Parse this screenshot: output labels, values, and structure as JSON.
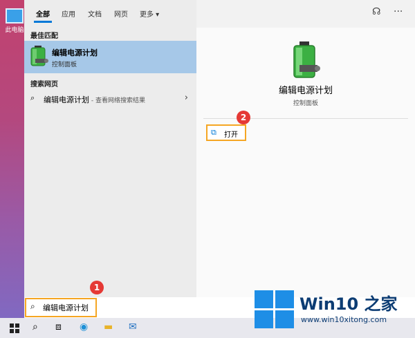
{
  "desktop": {
    "icon_label": "此电脑"
  },
  "tabs": [
    {
      "label": "全部"
    },
    {
      "label": "应用"
    },
    {
      "label": "文档"
    },
    {
      "label": "网页"
    },
    {
      "label": "更多 ▾"
    }
  ],
  "sections": {
    "best_match": "最佳匹配",
    "web_search": "搜索网页"
  },
  "best_match": {
    "title": "编辑电源计划",
    "subtitle": "控制面板"
  },
  "web_result": {
    "text": "编辑电源计划",
    "sub": " - 查看网络搜索结果"
  },
  "detail": {
    "title": "编辑电源计划",
    "subtitle": "控制面板",
    "open_label": "打开"
  },
  "badges": {
    "one": "1",
    "two": "2"
  },
  "search": {
    "value": "编辑电源计划"
  },
  "brand": {
    "name": "Win10 之家",
    "url": "www.win10xitong.com"
  },
  "colors": {
    "accent": "#0078d7",
    "highlight": "#f5a623",
    "badge": "#e53935",
    "selected": "#a6c8e8"
  }
}
